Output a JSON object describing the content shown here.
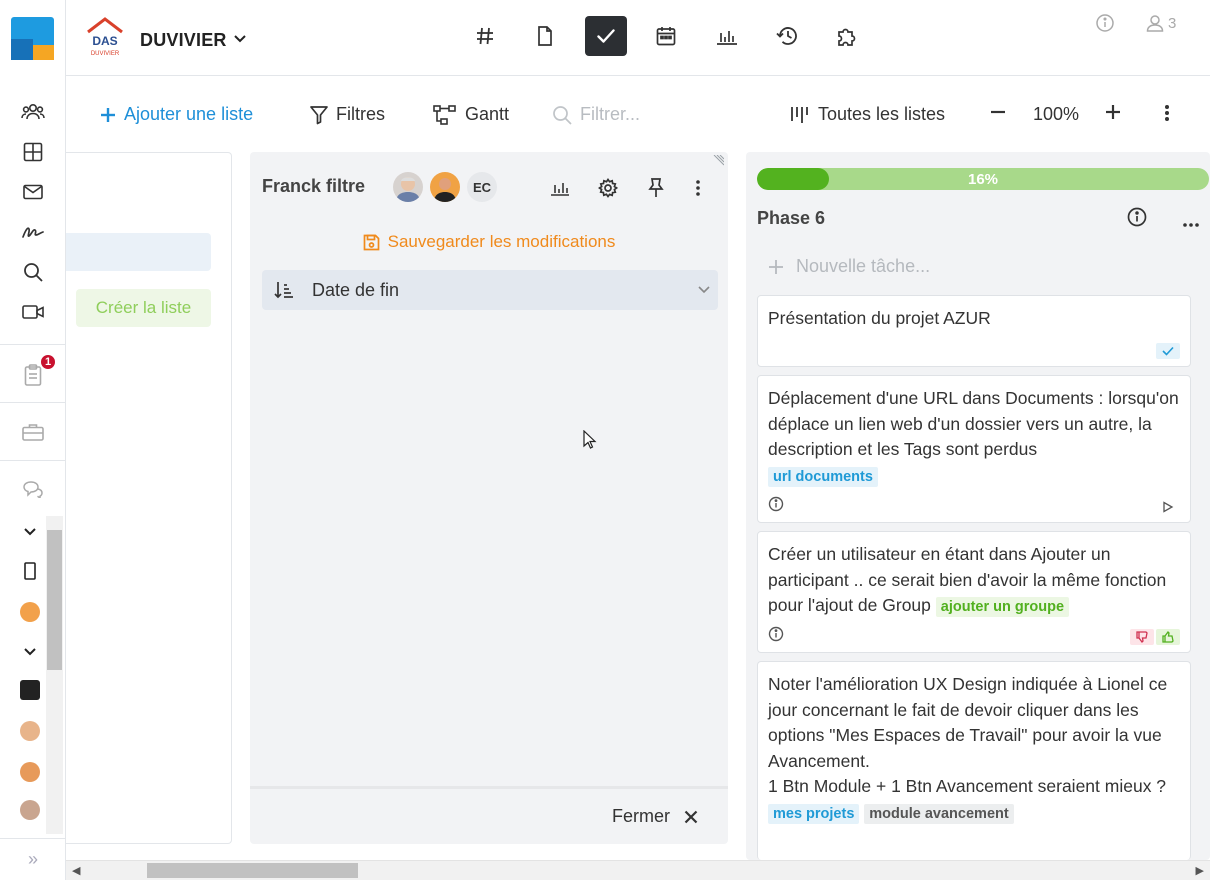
{
  "app": {
    "name": "DUVIVIER",
    "user_count": "3",
    "logo_text": "DAS",
    "logo_subtext": "DUVIVIER"
  },
  "rail": {
    "notifications_badge": "1"
  },
  "toolbar": {
    "add_list": "Ajouter une liste",
    "filters": "Filtres",
    "gantt": "Gantt",
    "search_placeholder": "Filtrer...",
    "all_lists": "Toutes les listes",
    "zoom": "100%"
  },
  "left_column": {
    "create_list": "Créer la liste"
  },
  "filter_column": {
    "title": "Franck filtre",
    "member_initials": "EC",
    "save_label": "Sauvegarder les modifications",
    "sort_label": "Date de fin",
    "close_label": "Fermer"
  },
  "phase_column": {
    "progress_label": "16%",
    "progress_value": 0.16,
    "title": "Phase 6",
    "new_task_placeholder": "Nouvelle tâche...",
    "cards": [
      {
        "text": "Présentation du projet AZUR",
        "tags": []
      },
      {
        "text": "Déplacement d'une URL dans Documents : lorsqu'on déplace un lien web d'un dossier vers un autre, la description et les Tags sont perdus",
        "tags": [
          "url documents"
        ]
      },
      {
        "text": "Créer un utilisateur en étant dans Ajouter un participant .. ce serait bien d'avoir la même fonction pour l'ajout de Group",
        "tags": [
          "ajouter un groupe"
        ]
      },
      {
        "text": "Noter l'amélioration UX Design indiquée à Lionel ce jour concernant le fait de devoir cliquer dans les options \"Mes Espaces de Travail\" pour avoir la vue Avancement.",
        "text2": "1 Btn Module + 1 Btn Avancement seraient mieux ?",
        "tags": [
          "mes projets",
          "module avancement"
        ]
      }
    ]
  },
  "colors": {
    "accent": "#1e8fd8",
    "progress_fill": "#53b21f",
    "progress_bg": "#a8d98a",
    "save": "#f08a1c",
    "badge": "#c8102e"
  }
}
